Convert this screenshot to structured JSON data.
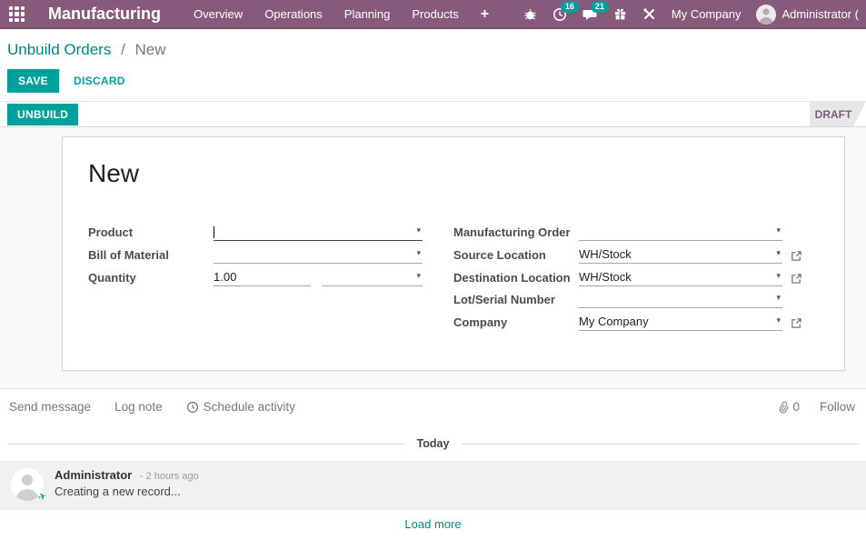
{
  "navbar": {
    "app_title": "Manufacturing",
    "menu": [
      "Overview",
      "Operations",
      "Planning",
      "Products"
    ],
    "plus": "+",
    "activities_badge": "16",
    "messages_badge": "21",
    "company": "My Company",
    "user": "Administrator",
    "user_suffix": "("
  },
  "breadcrumb": {
    "parent": "Unbuild Orders",
    "separator": "/",
    "current": "New"
  },
  "control_buttons": {
    "save": "SAVE",
    "discard": "DISCARD"
  },
  "statusbar": {
    "action": "UNBUILD",
    "state": "DRAFT"
  },
  "form": {
    "title": "New",
    "fields": {
      "product": {
        "label": "Product",
        "value": ""
      },
      "bom": {
        "label": "Bill of Material",
        "value": ""
      },
      "quantity": {
        "label": "Quantity",
        "value": "1.00",
        "uom": ""
      },
      "mo": {
        "label": "Manufacturing Order",
        "value": ""
      },
      "source": {
        "label": "Source Location",
        "value": "WH/Stock"
      },
      "destination": {
        "label": "Destination Location",
        "value": "WH/Stock"
      },
      "lot": {
        "label": "Lot/Serial Number",
        "value": ""
      },
      "company": {
        "label": "Company",
        "value": "My Company"
      }
    }
  },
  "chatter": {
    "send_message": "Send message",
    "log_note": "Log note",
    "schedule_activity": "Schedule activity",
    "attachments": "0",
    "follow": "Follow",
    "divider": "Today",
    "message": {
      "author": "Administrator",
      "timestamp": "- 2 hours ago",
      "body": "Creating a new record..."
    },
    "load_more": "Load more"
  },
  "icons": {
    "dropdown": "▾",
    "note_plane": "✈",
    "apps_grid": "grid-3x3",
    "bug": "bug",
    "activities": "clock",
    "messages": "chat-bubble",
    "gift": "gift",
    "tools": "crossed-tools",
    "external_link": "external-link",
    "paperclip": "paperclip",
    "schedule": "clock-outline",
    "avatar": "person-silhouette"
  },
  "colors": {
    "navbar": "#875A7B",
    "primary": "#00A09D",
    "link": "#008784",
    "state_text": "#875A7B"
  }
}
